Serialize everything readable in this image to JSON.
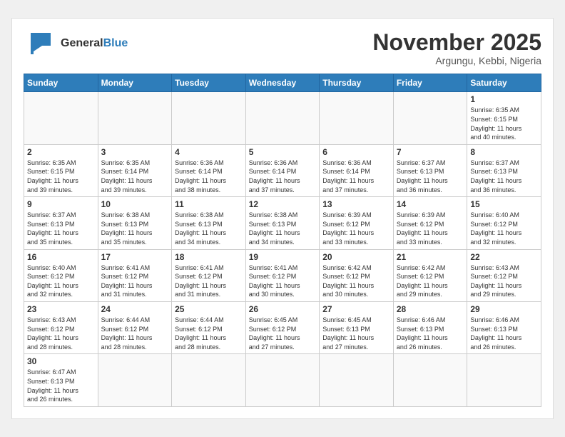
{
  "header": {
    "logo_general": "General",
    "logo_blue": "Blue",
    "month_title": "November 2025",
    "location": "Argungu, Kebbi, Nigeria"
  },
  "weekdays": [
    "Sunday",
    "Monday",
    "Tuesday",
    "Wednesday",
    "Thursday",
    "Friday",
    "Saturday"
  ],
  "weeks": [
    [
      {
        "day": "",
        "info": ""
      },
      {
        "day": "",
        "info": ""
      },
      {
        "day": "",
        "info": ""
      },
      {
        "day": "",
        "info": ""
      },
      {
        "day": "",
        "info": ""
      },
      {
        "day": "",
        "info": ""
      },
      {
        "day": "1",
        "info": "Sunrise: 6:35 AM\nSunset: 6:15 PM\nDaylight: 11 hours\nand 40 minutes."
      }
    ],
    [
      {
        "day": "2",
        "info": "Sunrise: 6:35 AM\nSunset: 6:15 PM\nDaylight: 11 hours\nand 39 minutes."
      },
      {
        "day": "3",
        "info": "Sunrise: 6:35 AM\nSunset: 6:14 PM\nDaylight: 11 hours\nand 39 minutes."
      },
      {
        "day": "4",
        "info": "Sunrise: 6:36 AM\nSunset: 6:14 PM\nDaylight: 11 hours\nand 38 minutes."
      },
      {
        "day": "5",
        "info": "Sunrise: 6:36 AM\nSunset: 6:14 PM\nDaylight: 11 hours\nand 37 minutes."
      },
      {
        "day": "6",
        "info": "Sunrise: 6:36 AM\nSunset: 6:14 PM\nDaylight: 11 hours\nand 37 minutes."
      },
      {
        "day": "7",
        "info": "Sunrise: 6:37 AM\nSunset: 6:13 PM\nDaylight: 11 hours\nand 36 minutes."
      },
      {
        "day": "8",
        "info": "Sunrise: 6:37 AM\nSunset: 6:13 PM\nDaylight: 11 hours\nand 36 minutes."
      }
    ],
    [
      {
        "day": "9",
        "info": "Sunrise: 6:37 AM\nSunset: 6:13 PM\nDaylight: 11 hours\nand 35 minutes."
      },
      {
        "day": "10",
        "info": "Sunrise: 6:38 AM\nSunset: 6:13 PM\nDaylight: 11 hours\nand 35 minutes."
      },
      {
        "day": "11",
        "info": "Sunrise: 6:38 AM\nSunset: 6:13 PM\nDaylight: 11 hours\nand 34 minutes."
      },
      {
        "day": "12",
        "info": "Sunrise: 6:38 AM\nSunset: 6:13 PM\nDaylight: 11 hours\nand 34 minutes."
      },
      {
        "day": "13",
        "info": "Sunrise: 6:39 AM\nSunset: 6:12 PM\nDaylight: 11 hours\nand 33 minutes."
      },
      {
        "day": "14",
        "info": "Sunrise: 6:39 AM\nSunset: 6:12 PM\nDaylight: 11 hours\nand 33 minutes."
      },
      {
        "day": "15",
        "info": "Sunrise: 6:40 AM\nSunset: 6:12 PM\nDaylight: 11 hours\nand 32 minutes."
      }
    ],
    [
      {
        "day": "16",
        "info": "Sunrise: 6:40 AM\nSunset: 6:12 PM\nDaylight: 11 hours\nand 32 minutes."
      },
      {
        "day": "17",
        "info": "Sunrise: 6:41 AM\nSunset: 6:12 PM\nDaylight: 11 hours\nand 31 minutes."
      },
      {
        "day": "18",
        "info": "Sunrise: 6:41 AM\nSunset: 6:12 PM\nDaylight: 11 hours\nand 31 minutes."
      },
      {
        "day": "19",
        "info": "Sunrise: 6:41 AM\nSunset: 6:12 PM\nDaylight: 11 hours\nand 30 minutes."
      },
      {
        "day": "20",
        "info": "Sunrise: 6:42 AM\nSunset: 6:12 PM\nDaylight: 11 hours\nand 30 minutes."
      },
      {
        "day": "21",
        "info": "Sunrise: 6:42 AM\nSunset: 6:12 PM\nDaylight: 11 hours\nand 29 minutes."
      },
      {
        "day": "22",
        "info": "Sunrise: 6:43 AM\nSunset: 6:12 PM\nDaylight: 11 hours\nand 29 minutes."
      }
    ],
    [
      {
        "day": "23",
        "info": "Sunrise: 6:43 AM\nSunset: 6:12 PM\nDaylight: 11 hours\nand 28 minutes."
      },
      {
        "day": "24",
        "info": "Sunrise: 6:44 AM\nSunset: 6:12 PM\nDaylight: 11 hours\nand 28 minutes."
      },
      {
        "day": "25",
        "info": "Sunrise: 6:44 AM\nSunset: 6:12 PM\nDaylight: 11 hours\nand 28 minutes."
      },
      {
        "day": "26",
        "info": "Sunrise: 6:45 AM\nSunset: 6:12 PM\nDaylight: 11 hours\nand 27 minutes."
      },
      {
        "day": "27",
        "info": "Sunrise: 6:45 AM\nSunset: 6:13 PM\nDaylight: 11 hours\nand 27 minutes."
      },
      {
        "day": "28",
        "info": "Sunrise: 6:46 AM\nSunset: 6:13 PM\nDaylight: 11 hours\nand 26 minutes."
      },
      {
        "day": "29",
        "info": "Sunrise: 6:46 AM\nSunset: 6:13 PM\nDaylight: 11 hours\nand 26 minutes."
      }
    ],
    [
      {
        "day": "30",
        "info": "Sunrise: 6:47 AM\nSunset: 6:13 PM\nDaylight: 11 hours\nand 26 minutes."
      },
      {
        "day": "",
        "info": ""
      },
      {
        "day": "",
        "info": ""
      },
      {
        "day": "",
        "info": ""
      },
      {
        "day": "",
        "info": ""
      },
      {
        "day": "",
        "info": ""
      },
      {
        "day": "",
        "info": ""
      }
    ]
  ]
}
